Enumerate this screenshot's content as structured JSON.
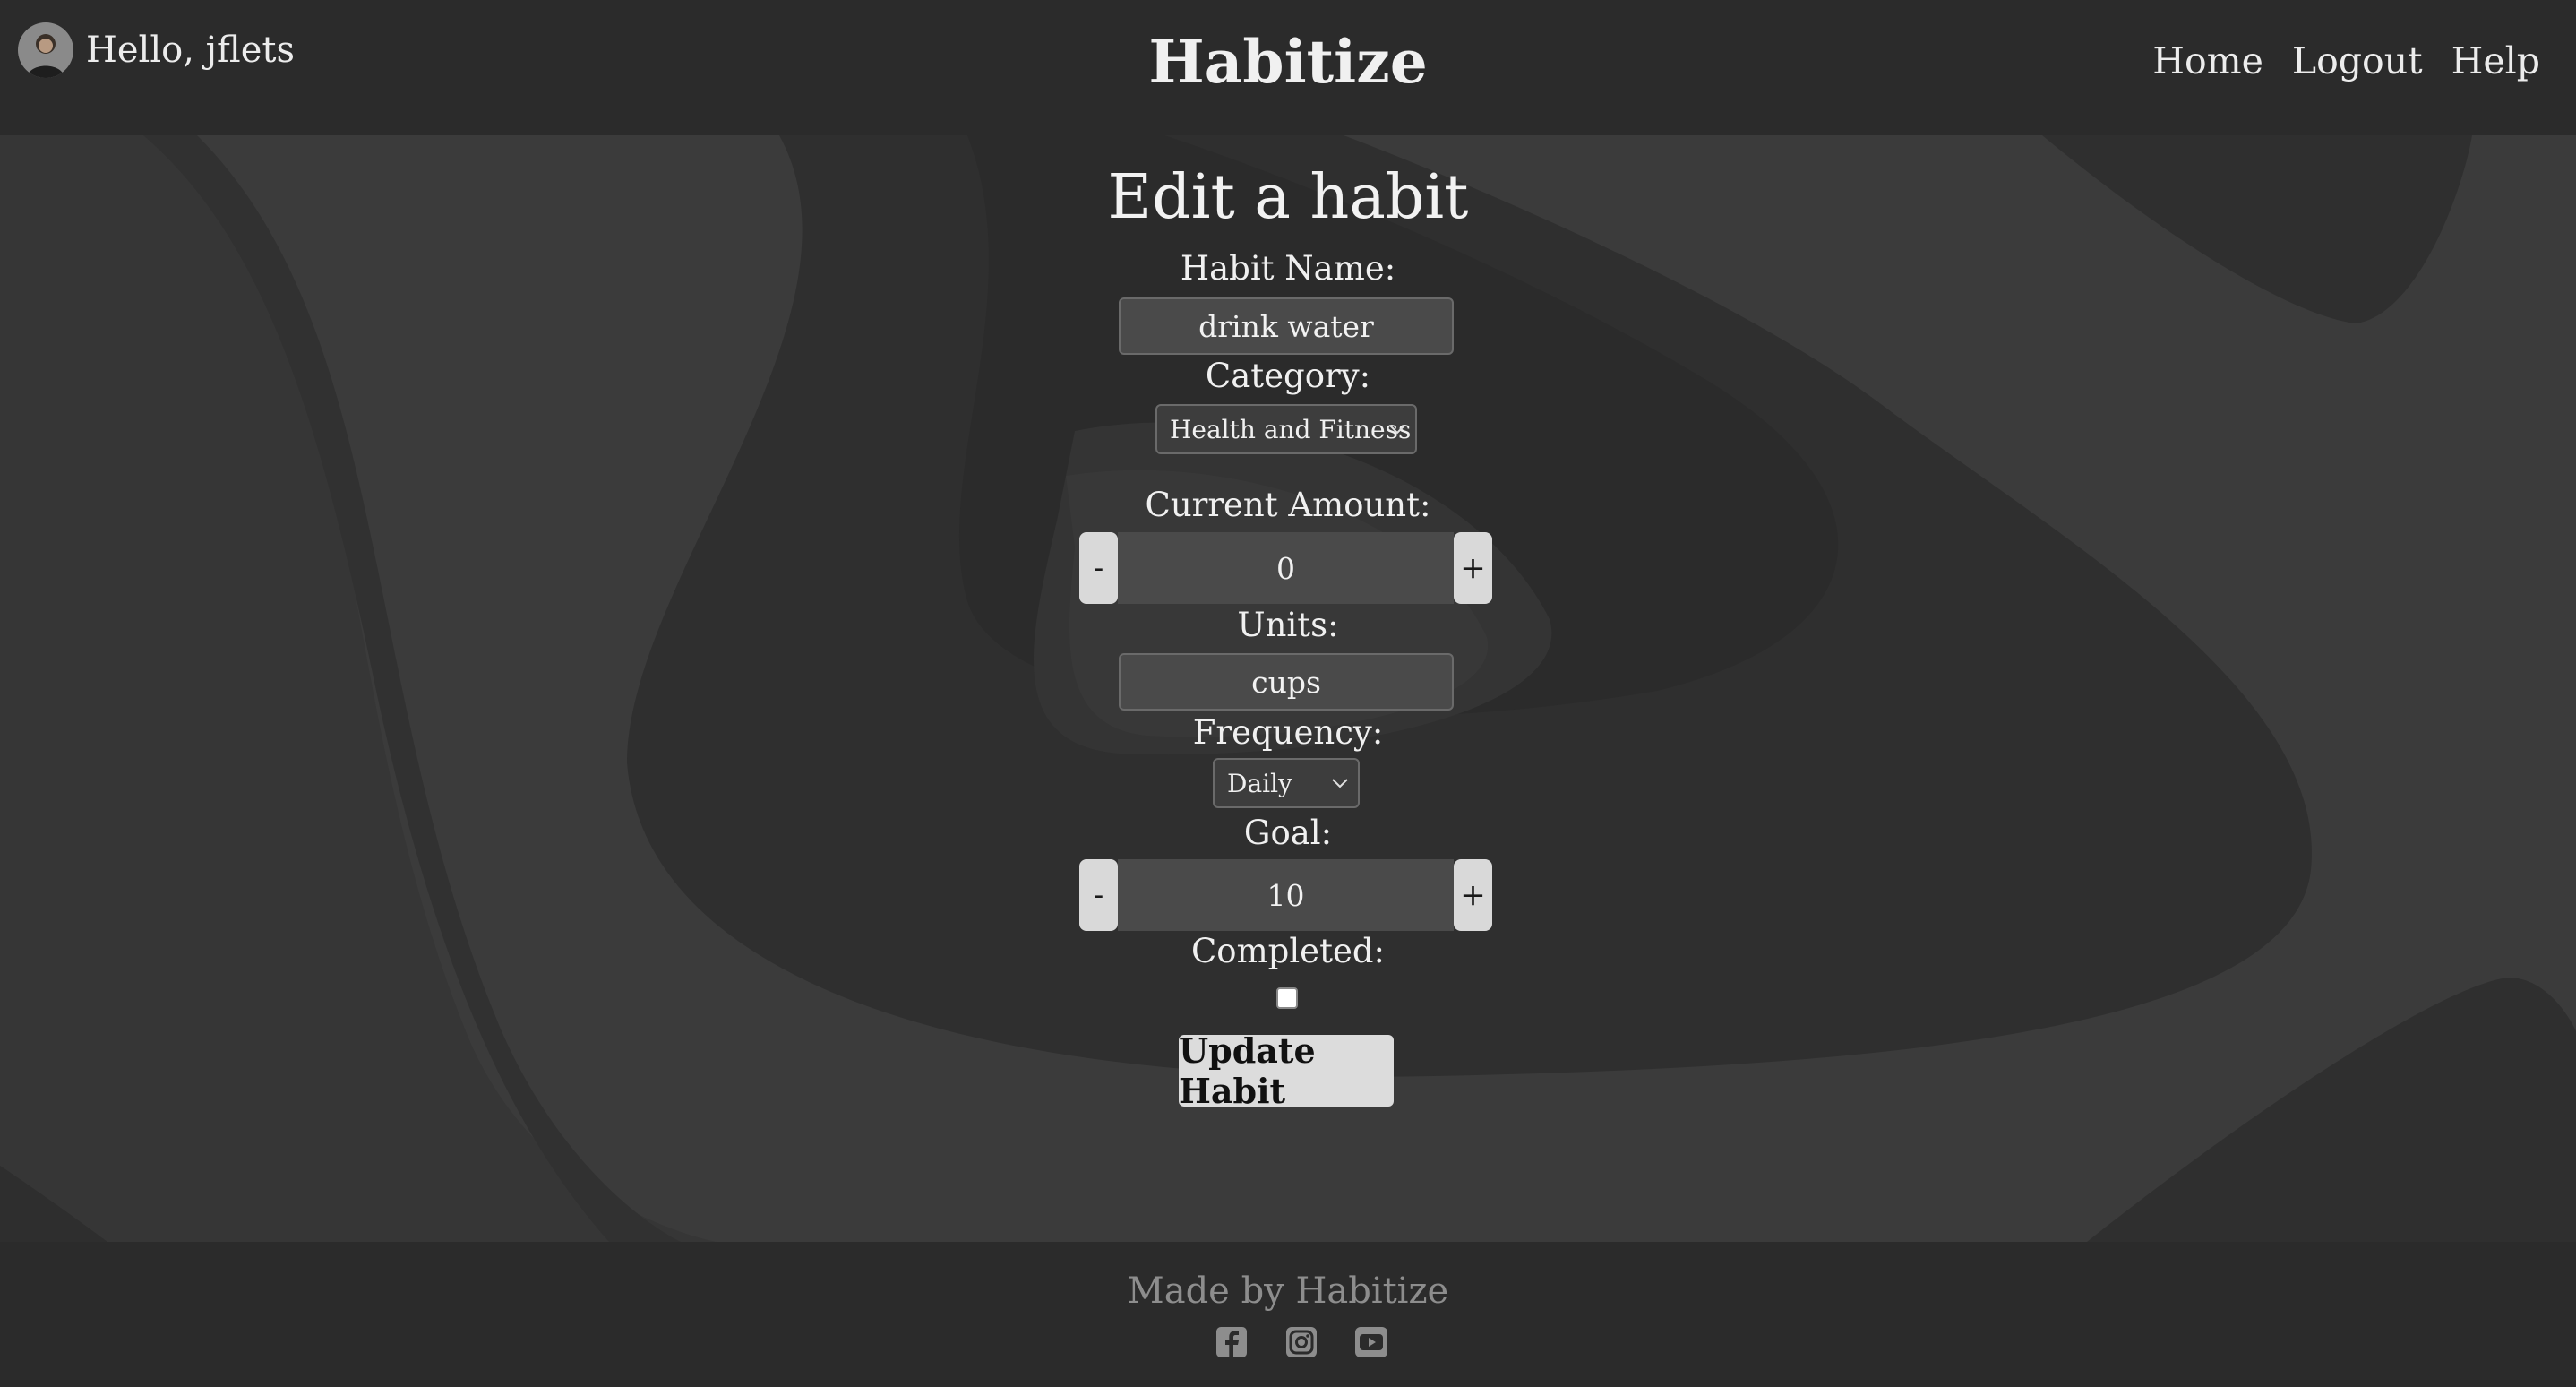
{
  "header": {
    "greeting": "Hello, jflets",
    "brand": "Habitize",
    "nav": [
      "Home",
      "Logout",
      "Help"
    ]
  },
  "form": {
    "title": "Edit a habit",
    "habit_name": {
      "label": "Habit Name:",
      "value": "drink water"
    },
    "category": {
      "label": "Category:",
      "selected": "Health and Fitness"
    },
    "current_amount": {
      "label": "Current Amount:",
      "value": "0",
      "minus": "-",
      "plus": "+"
    },
    "units": {
      "label": "Units:",
      "value": "cups"
    },
    "frequency": {
      "label": "Frequency:",
      "selected": "Daily"
    },
    "goal": {
      "label": "Goal:",
      "value": "10",
      "minus": "-",
      "plus": "+"
    },
    "completed": {
      "label": "Completed:",
      "checked": false
    },
    "submit_label": "Update Habit"
  },
  "footer": {
    "made_by": "Made by Habitize",
    "icons": [
      "facebook-icon",
      "instagram-icon",
      "youtube-icon"
    ]
  },
  "colors": {
    "header_bg": "#2b2b2b",
    "background": "#3a3a3a",
    "button_bg": "#d9d9d9",
    "input_bg": "#4a4a4a",
    "footer_text": "#8d8d8d"
  }
}
